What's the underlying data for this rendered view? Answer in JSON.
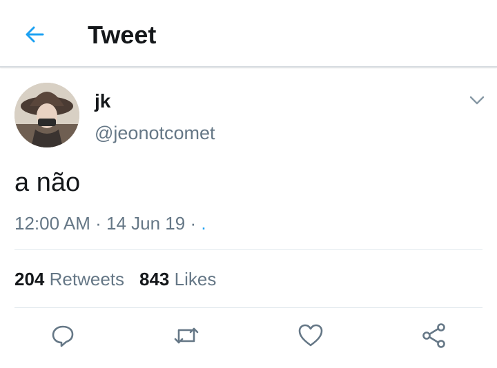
{
  "header": {
    "title": "Tweet",
    "back_icon": "back-arrow-icon",
    "accent": "#1da1f2"
  },
  "tweet": {
    "author": {
      "name": "jk",
      "handle": "@jeonotcomet"
    },
    "text": "a não",
    "time": "12:00 AM",
    "date": "14 Jun 19",
    "separator": "·",
    "source": "."
  },
  "stats": {
    "retweets": {
      "count": "204",
      "label": "Retweets"
    },
    "likes": {
      "count": "843",
      "label": "Likes"
    }
  },
  "actions": [
    {
      "icon": "reply-icon"
    },
    {
      "icon": "retweet-icon"
    },
    {
      "icon": "like-icon"
    },
    {
      "icon": "share-icon"
    }
  ],
  "colors": {
    "text": "#14171a",
    "secondary": "#657786",
    "divider": "#e1e8ed"
  }
}
